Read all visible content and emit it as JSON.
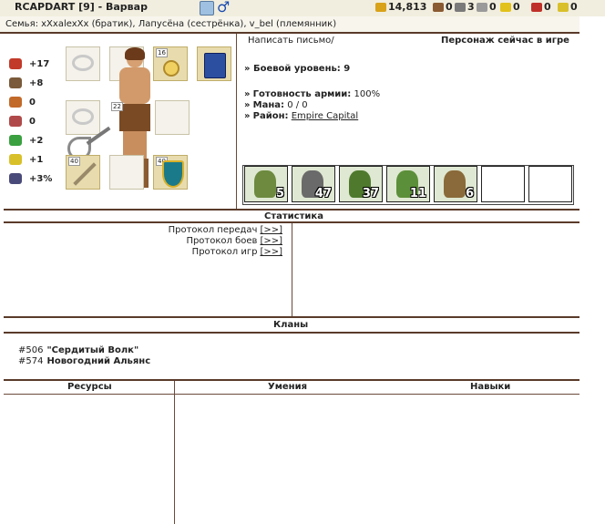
{
  "header": {
    "title": "RCAPDART  [9] - Варвар",
    "resources": [
      {
        "icon": "gold-icon",
        "value": "14,813",
        "color": "#d8a21a"
      },
      {
        "icon": "wood-icon",
        "value": "0",
        "color": "#8a5a32"
      },
      {
        "icon": "ore-icon",
        "value": "3",
        "color": "#7a7a7a"
      },
      {
        "icon": "mercury-icon",
        "value": "0",
        "color": "#9a9a9a"
      },
      {
        "icon": "sulfur-icon",
        "value": "0",
        "color": "#e2c21a"
      },
      {
        "icon": "crystal-icon",
        "value": "0",
        "color": "#c0302a"
      },
      {
        "icon": "gems-icon",
        "value": "0",
        "color": "#d9c02a"
      }
    ]
  },
  "family": "Семья: xXxalexXx (братик), Лапусёна (сестрёнка), v_bel (племянник)",
  "stats": [
    {
      "icon": "attack-icon",
      "value": "+17"
    },
    {
      "icon": "defense-icon",
      "value": "+8"
    },
    {
      "icon": "spellpower-icon",
      "value": "0"
    },
    {
      "icon": "knowledge-icon",
      "value": "0"
    },
    {
      "icon": "luck-icon",
      "value": "+2"
    },
    {
      "icon": "morale-icon",
      "value": "+1"
    },
    {
      "icon": "initiative-icon",
      "value": "+3%"
    }
  ],
  "equipment": {
    "slot_levels": {
      "amulet": "16",
      "body": "22",
      "weapon": "40",
      "shield": "40"
    }
  },
  "info": {
    "write_letter": "Написать письмо/",
    "online_status": "Персонаж сейчас в игре",
    "combat_level_label": "Боевой уровень:",
    "combat_level": "9",
    "army_ready_label": "Готовность армии:",
    "army_ready": "100%",
    "mana_label": "Мана:",
    "mana": "0 / 0",
    "district_label": "Район:",
    "district": "Empire Capital"
  },
  "army": [
    {
      "name": "orc-unit",
      "count": "5",
      "color": "#6d8a3f"
    },
    {
      "name": "wolf-unit",
      "count": "47",
      "color": "#6a6a6a"
    },
    {
      "name": "goblin-shaman-unit",
      "count": "37",
      "color": "#4f7a2e"
    },
    {
      "name": "goblin-unit",
      "count": "11",
      "color": "#5c8f3a"
    },
    {
      "name": "griffin-unit",
      "count": "6",
      "color": "#8a6a3a"
    },
    {
      "name": "empty",
      "count": ""
    },
    {
      "name": "empty",
      "count": ""
    }
  ],
  "statistics": {
    "title": "Статистика",
    "links": [
      {
        "label": "Протокол передач",
        "link": "[>>]"
      },
      {
        "label": "Протокол боев",
        "link": "[>>]"
      },
      {
        "label": "Протокол игр",
        "link": "[>>]"
      }
    ]
  },
  "clans": {
    "title": "Кланы",
    "items": [
      {
        "id": "#506",
        "name": "\"Сердитый Волк\""
      },
      {
        "id": "#574",
        "name": "Новогодний Альянс"
      }
    ]
  },
  "bottom": {
    "resources_title": "Ресурсы",
    "skills_title": "Умения",
    "abilities_title": "Навыки"
  }
}
